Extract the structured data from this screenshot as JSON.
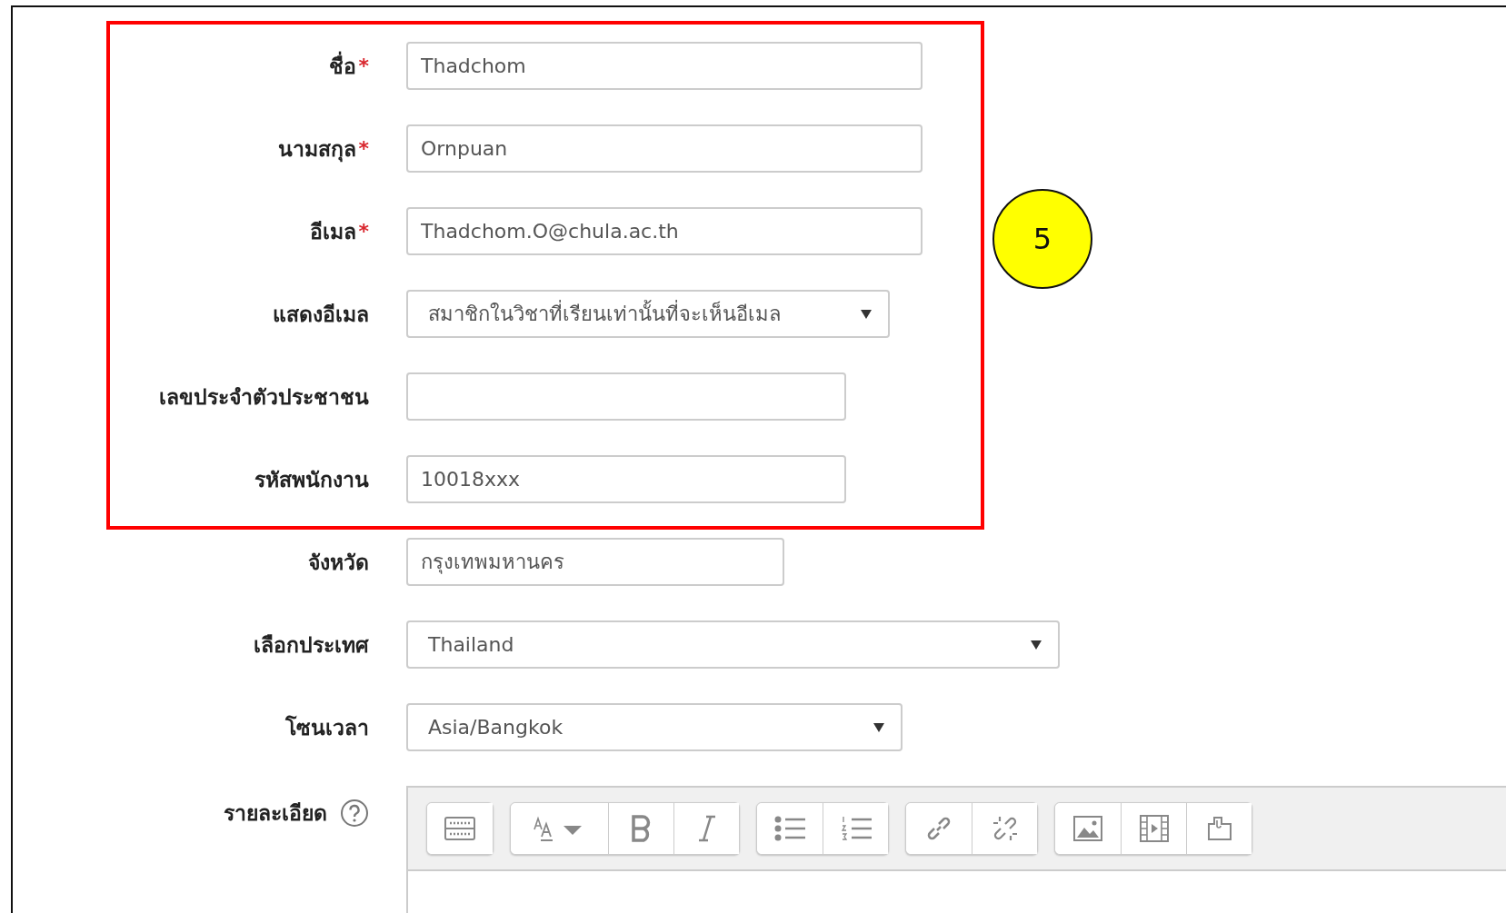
{
  "fields": [
    {
      "kind": "text",
      "label": "ชื่อ",
      "mark": "*",
      "value": "Thadchom"
    },
    {
      "kind": "text",
      "label": "นามสกุล",
      "mark": "*",
      "value": "Ornpuan"
    },
    {
      "kind": "text",
      "label": "อีเมล",
      "mark": "*",
      "value": "Thadchom.O@chula.ac.th"
    },
    {
      "kind": "select",
      "label": "แสดงอีเมล",
      "value": "สมาชิกในวิชาที่เรียนเท่านั้นที่จะเห็นอีเมล"
    },
    {
      "kind": "text",
      "label": "เลขประจำตัวประชาชน"
    },
    {
      "kind": "text",
      "label": "รหัสพนักงาน",
      "value": "10018xxx"
    },
    {
      "kind": "text",
      "label": "จังหวัด",
      "value": "กรุงเทพมหานคร"
    },
    {
      "kind": "select",
      "label": "เลือกประเทศ",
      "value": "Thailand"
    },
    {
      "kind": "select",
      "label": "โซนเวลา",
      "value": "Asia/Bangkok"
    },
    {
      "kind": "editor",
      "label": "รายละเอียด",
      "help": true
    }
  ],
  "toolbar": [
    [
      {
        "kind": "more"
      }
    ],
    [
      {
        "kind": "font"
      },
      {
        "kind": "bold"
      },
      {
        "kind": "italic"
      }
    ],
    [
      {
        "kind": "bullets"
      },
      {
        "kind": "numbers"
      }
    ],
    [
      {
        "kind": "link"
      },
      {
        "kind": "unlink"
      }
    ],
    [
      {
        "kind": "image"
      },
      {
        "kind": "media"
      },
      {
        "kind": "manage"
      }
    ]
  ],
  "annotation": {
    "number": "5"
  }
}
